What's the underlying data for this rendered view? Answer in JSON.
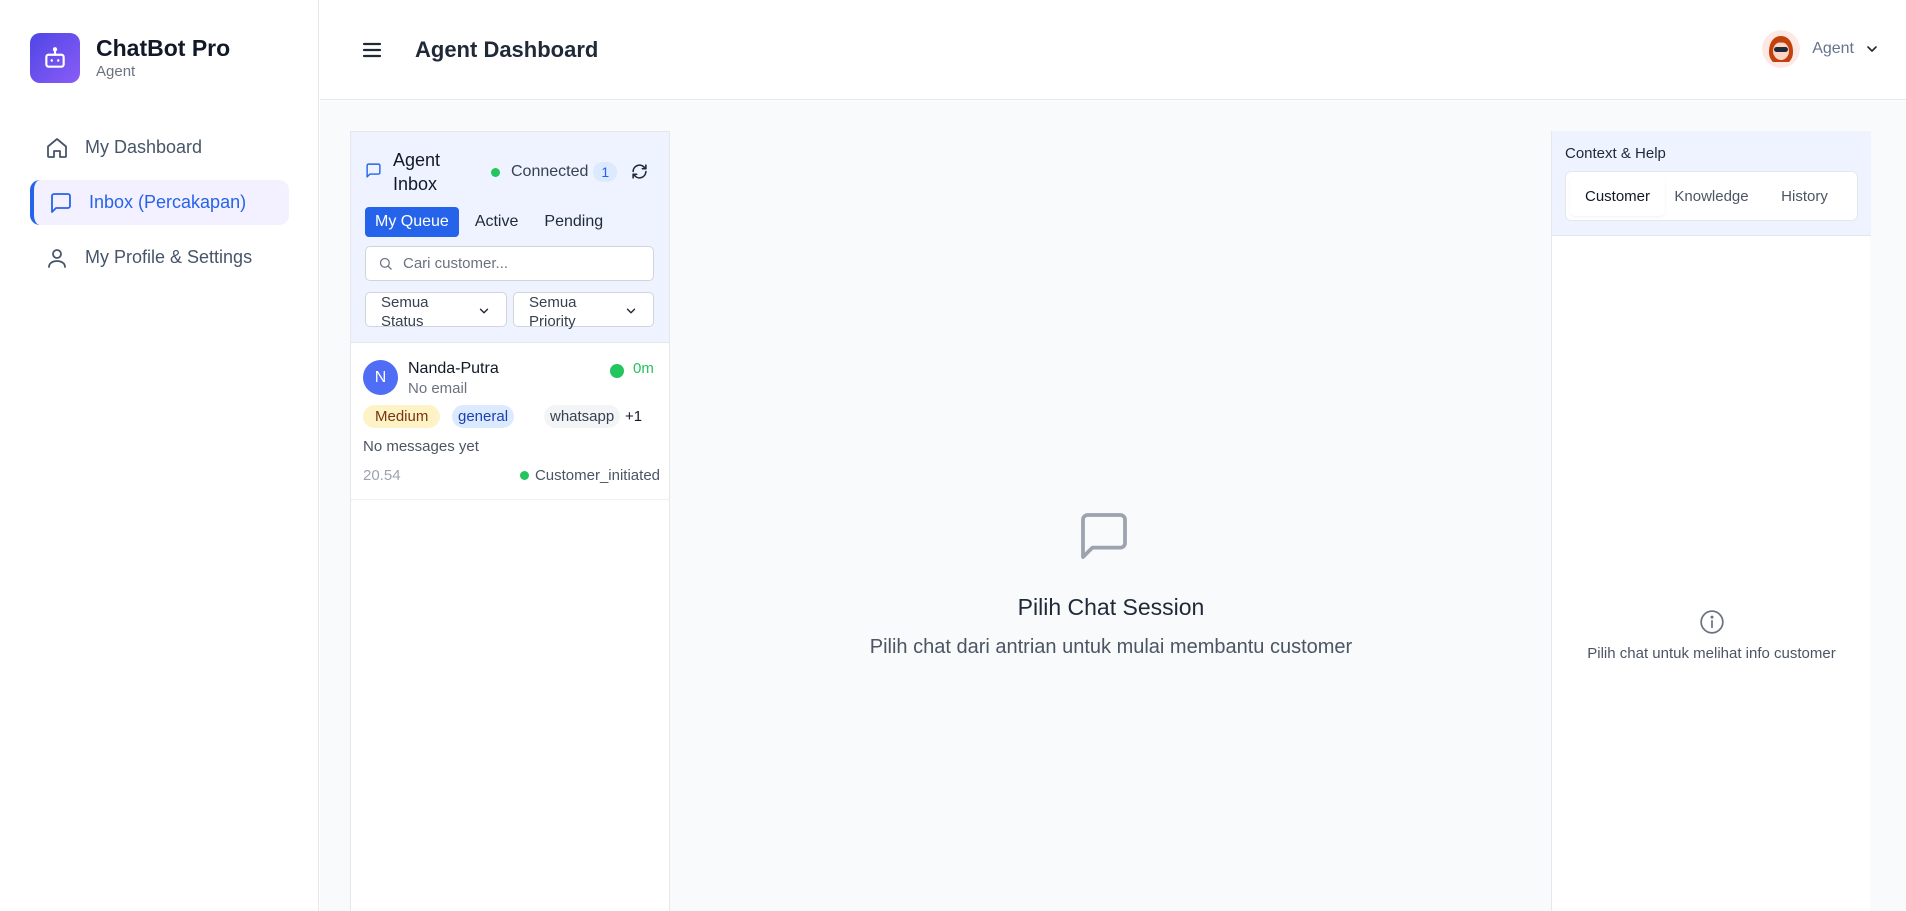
{
  "brand": {
    "name": "ChatBot Pro",
    "role": "Agent"
  },
  "nav": [
    {
      "label": "My Dashboard",
      "icon": "home-icon",
      "active": false
    },
    {
      "label": "Inbox (Percakapan)",
      "icon": "chat-bubble-icon",
      "active": true
    },
    {
      "label": "My Profile & Settings",
      "icon": "user-icon",
      "active": false
    }
  ],
  "header": {
    "title": "Agent Dashboard",
    "user_name": "Agent"
  },
  "inbox": {
    "title": "Agent Inbox",
    "status_label": "Connected",
    "status_count": "1",
    "tabs": [
      "My Queue",
      "Active",
      "Pending"
    ],
    "active_tab": "My Queue",
    "search_placeholder": "Cari customer...",
    "status_filter": "Semua Status",
    "priority_filter": "Semua Priority",
    "conversations": [
      {
        "initial": "N",
        "name": "Nanda-Putra",
        "email": "No email",
        "wait_time": "0m",
        "priority": "Medium",
        "category": "general",
        "channel": "whatsapp",
        "extra_tags": "+1",
        "preview": "No messages yet",
        "time": "20.54",
        "state": "Customer_initiated"
      }
    ]
  },
  "empty_state": {
    "title": "Pilih Chat Session",
    "subtitle": "Pilih chat dari antrian untuk mulai membantu customer"
  },
  "context": {
    "title": "Context & Help",
    "tabs": [
      "Customer",
      "Knowledge",
      "History"
    ],
    "active_tab": "Customer",
    "empty_text": "Pilih chat untuk melihat info customer"
  },
  "colors": {
    "accent": "#2563eb",
    "online": "#22c55e",
    "brand_gradient_start": "#4f46e5",
    "brand_gradient_end": "#8b5cf6"
  }
}
